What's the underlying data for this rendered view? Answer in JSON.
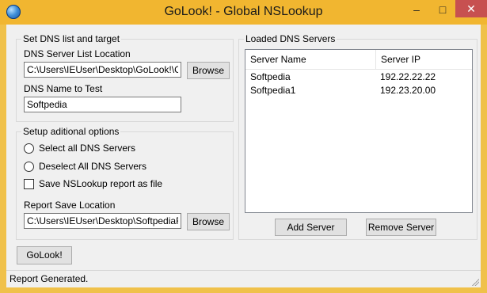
{
  "window": {
    "title": "GoLook! - Global NSLookup",
    "minimize_glyph": "–",
    "maximize_glyph": "□",
    "close_glyph": "✕"
  },
  "dns_group": {
    "legend": "Set DNS list and target",
    "server_list_label": "DNS Server List Location",
    "server_list_value": "C:\\Users\\IEUser\\Desktop\\GoLook!\\GoL",
    "browse_label": "Browse",
    "name_label": "DNS Name to Test",
    "name_value": "Softpedia"
  },
  "options_group": {
    "legend": "Setup aditional options",
    "select_all_label": "Select all DNS Servers",
    "select_all_checked": false,
    "deselect_all_label": "Deselect All DNS Servers",
    "deselect_all_checked": false,
    "save_report_label": "Save NSLookup report as file",
    "save_report_checked": false,
    "report_location_label": "Report Save Location",
    "report_location_value": "C:\\Users\\IEUser\\Desktop\\SoftpediaRep",
    "browse_label": "Browse"
  },
  "servers_group": {
    "legend": "Loaded DNS Servers",
    "columns": [
      "Server Name",
      "Server IP"
    ],
    "rows": [
      {
        "name": "Softpedia",
        "ip": "192.22.22.22"
      },
      {
        "name": "Softpedia1",
        "ip": "192.23.20.00"
      }
    ],
    "add_label": "Add Server",
    "remove_label": "Remove Server"
  },
  "golook_button": "GoLook!",
  "status": {
    "text": "Report Generated."
  },
  "colors": {
    "titlebar": "#f1b630",
    "close_button": "#c75050",
    "client_background": "#f0f0f0"
  }
}
